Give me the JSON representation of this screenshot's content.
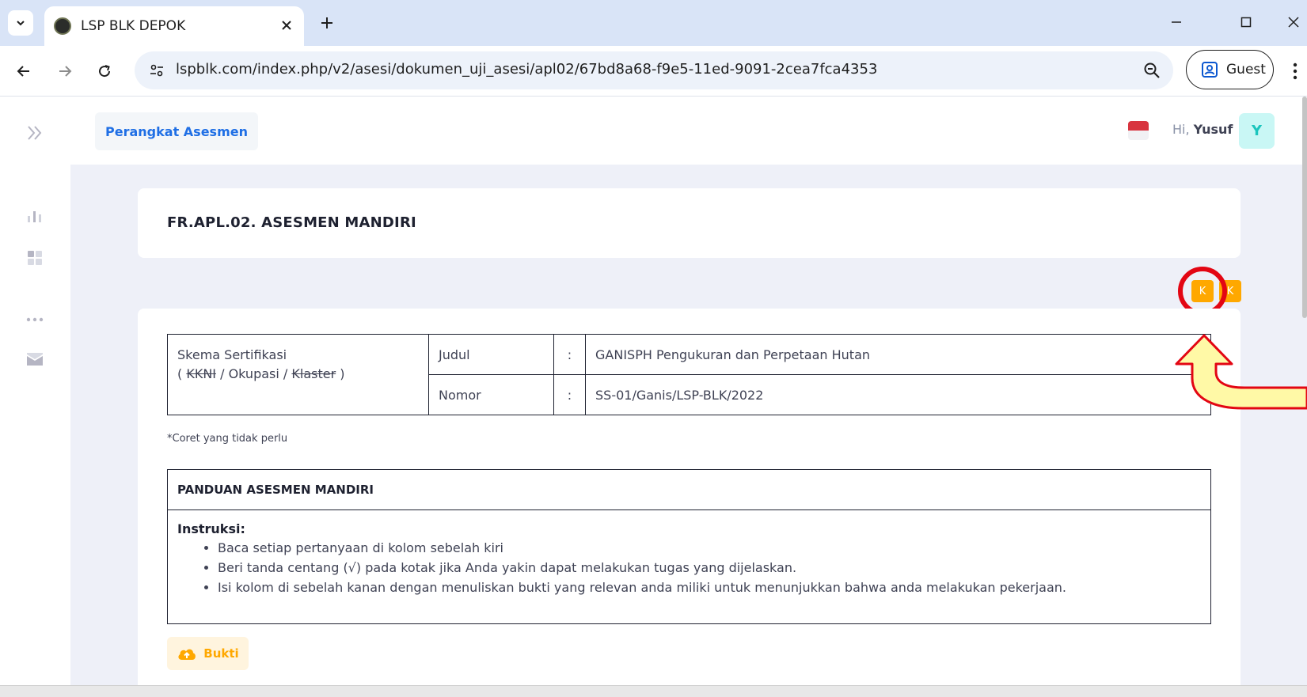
{
  "browser": {
    "tab_title": "LSP BLK DEPOK",
    "url": "lspblk.com/index.php/v2/asesi/dokumen_uji_asesi/apl02/67bd8a68-f9e5-11ed-9091-2cea7fca4353",
    "profile_label": "Guest"
  },
  "header": {
    "nav_button": "Perangkat Asesmen",
    "greeting_prefix": "Hi,",
    "user_name": "Yusuf",
    "avatar_initial": "Y"
  },
  "form": {
    "title": "FR.APL.02. ASESMEN MANDIRI",
    "k_buttons": [
      "K",
      "K"
    ],
    "scheme": {
      "label_line1": "Skema Sertifikasi",
      "label_open": "( ",
      "label_kkni": "KKNI",
      "label_sep1": " / Okupasi / ",
      "label_klaster": "Klaster",
      "label_close": " )",
      "rows": [
        {
          "key": "Judul",
          "colon": ":",
          "value": "GANISPH Pengukuran dan Perpetaan Hutan"
        },
        {
          "key": "Nomor",
          "colon": ":",
          "value": "SS-01/Ganis/LSP-BLK/2022"
        }
      ]
    },
    "note": "*Coret yang tidak perlu",
    "guide": {
      "heading": "PANDUAN ASESMEN MANDIRI",
      "instructions_label": "Instruksi:",
      "items": [
        "Baca setiap pertanyaan di kolom sebelah kiri",
        "Beri tanda centang (√) pada kotak jika Anda yakin dapat melakukan tugas yang dijelaskan.",
        "Isi kolom di sebelah kanan dengan menuliskan bukti yang relevan anda miliki untuk menunjukkan bahwa anda melakukan pekerjaan."
      ]
    },
    "evidence_button": "Bukti"
  },
  "colors": {
    "accent_blue": "#1f6fe5",
    "warning_orange": "#ffa800",
    "highlight_red": "#e30613",
    "callout_yellow": "#fff9a6"
  }
}
